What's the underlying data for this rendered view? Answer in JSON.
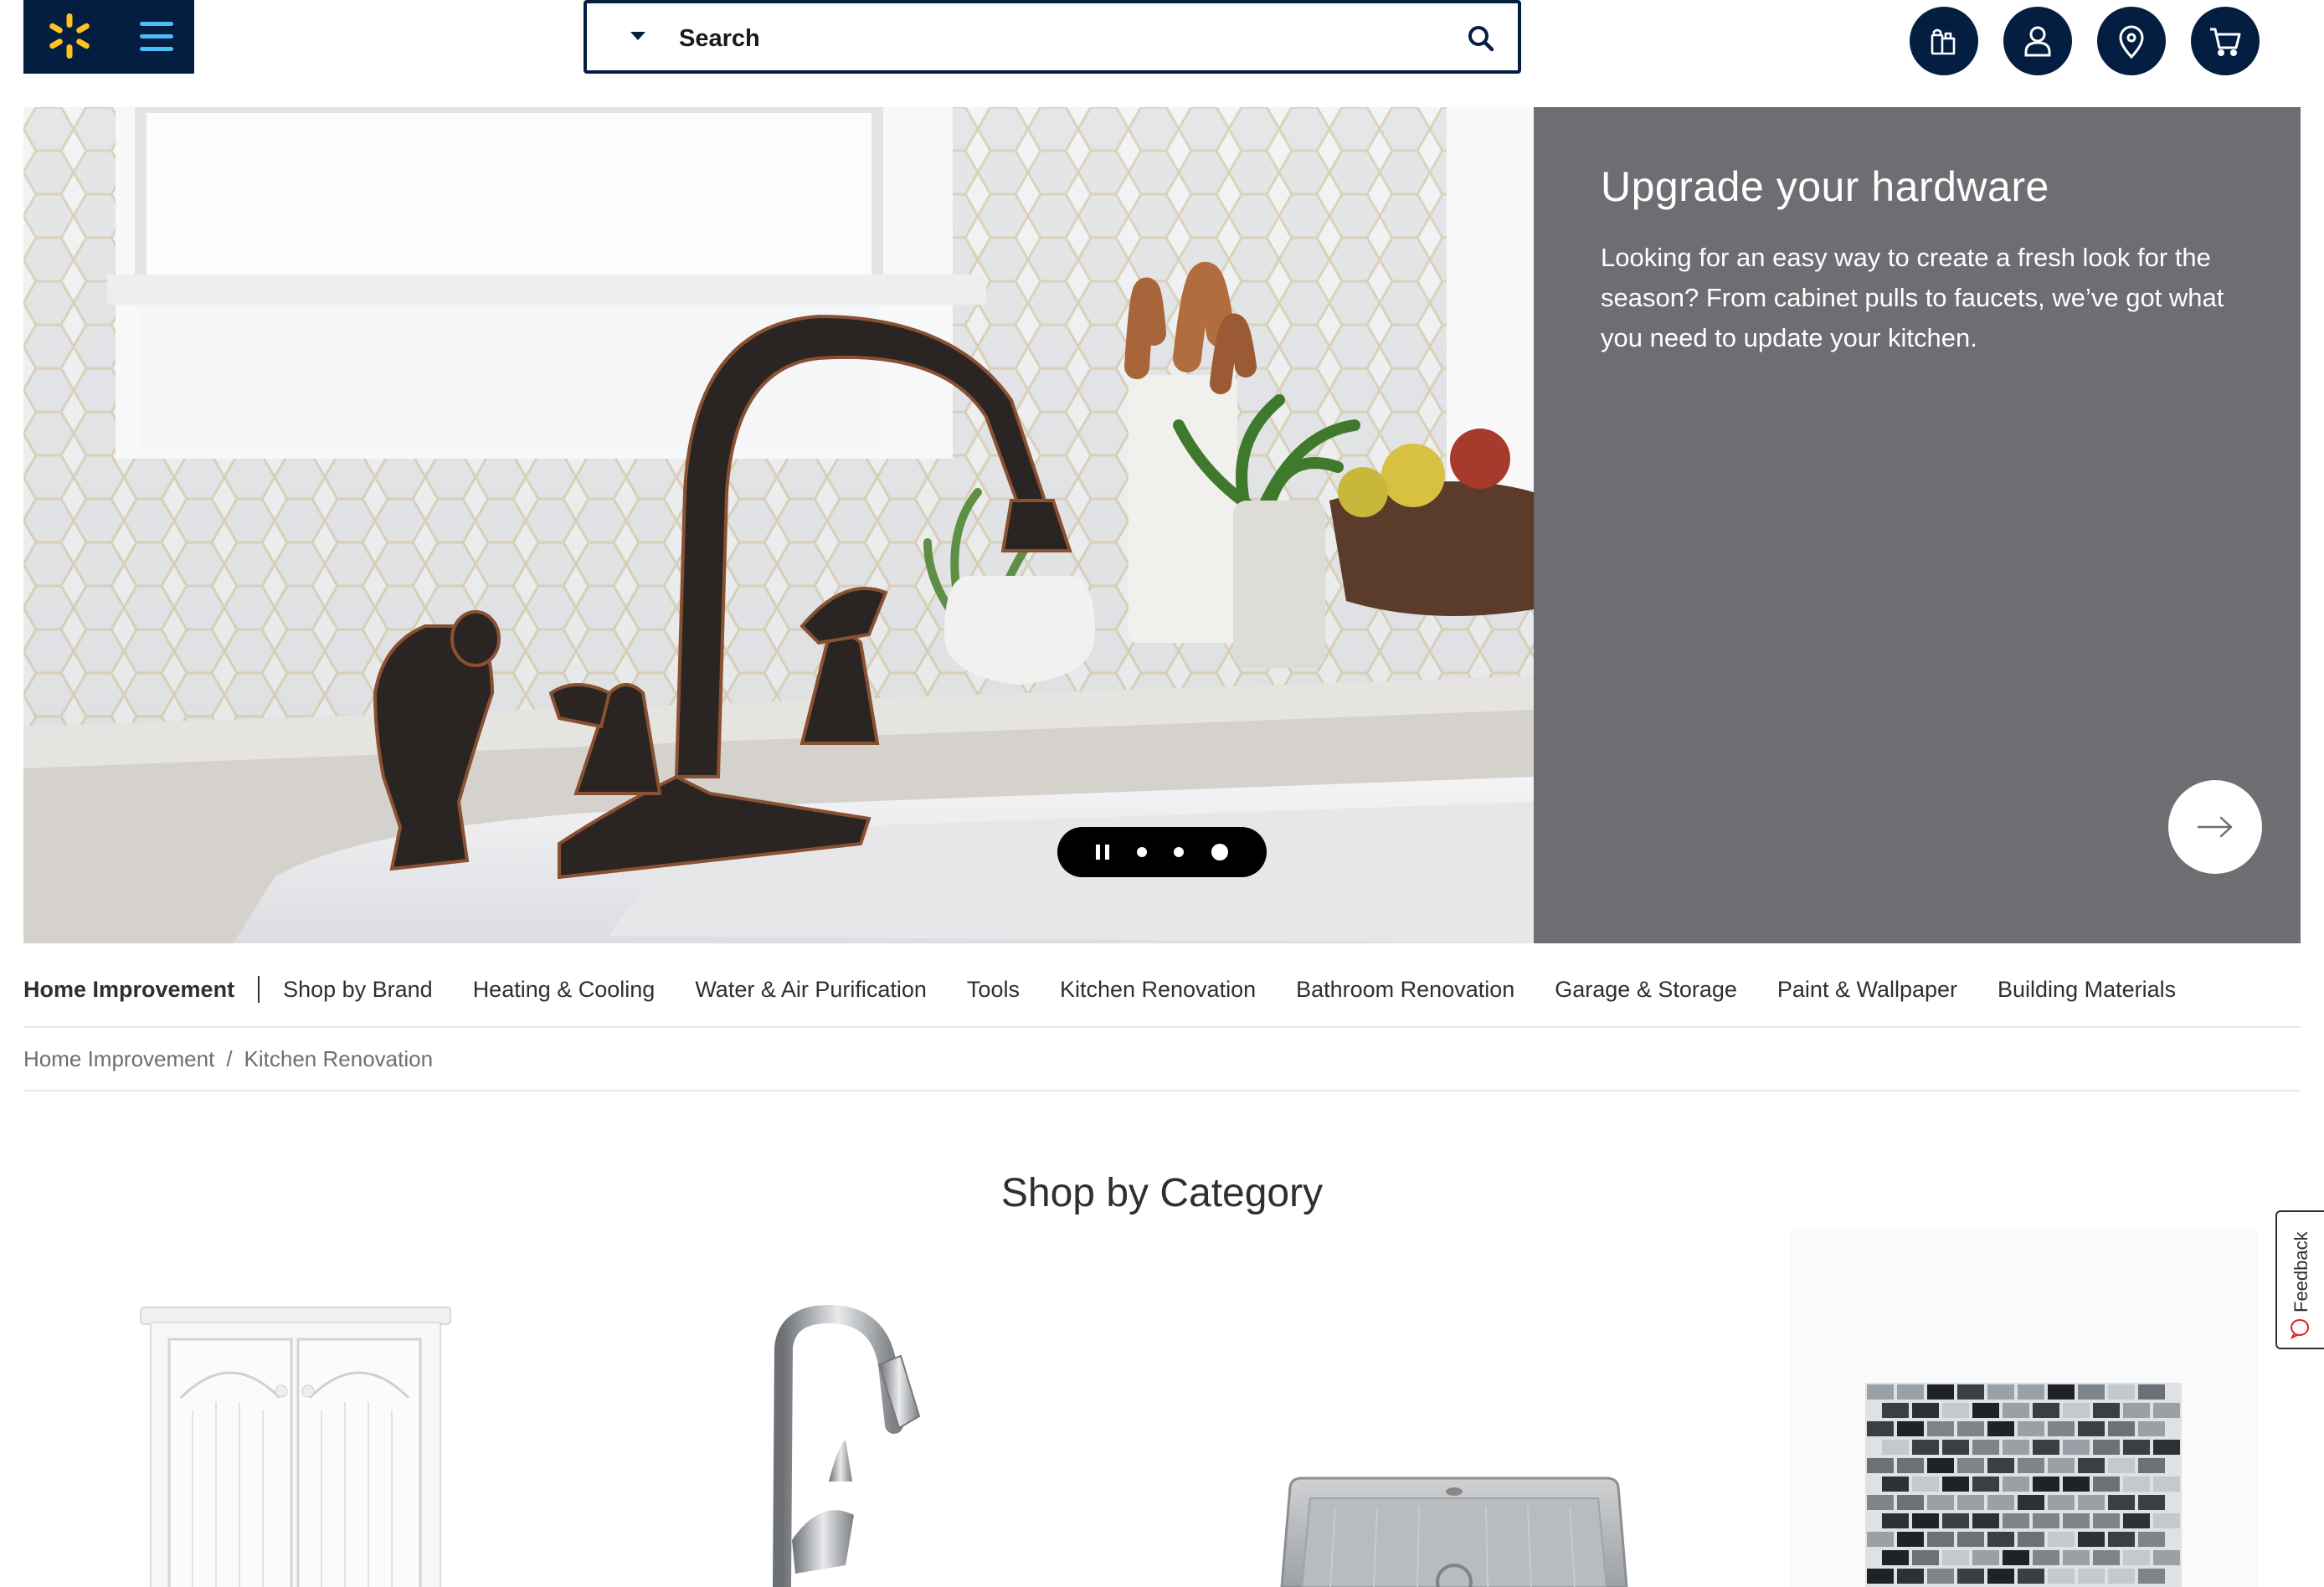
{
  "header": {
    "search_placeholder": "Search",
    "icons": [
      "spark-logo-icon",
      "menu-icon",
      "search-icon",
      "reorder-icon",
      "account-icon",
      "store-location-icon",
      "cart-icon"
    ]
  },
  "hero": {
    "title": "Upgrade your hardware",
    "body": "Looking for an easy way to create a fresh look for the season? From cabinet pulls to faucets, we’ve got what you need to update your kitchen.",
    "panel_color": "#6d6e72",
    "slide_count": 3,
    "active_slide": 3
  },
  "category_nav": {
    "home": "Home Improvement",
    "items": [
      "Shop by Brand",
      "Heating & Cooling",
      "Water & Air Purification",
      "Tools",
      "Kitchen Renovation",
      "Bathroom Renovation",
      "Garage & Storage",
      "Paint & Wallpaper",
      "Building Materials"
    ]
  },
  "breadcrumb": {
    "items": [
      "Home Improvement",
      "Kitchen Renovation"
    ],
    "separator": "/"
  },
  "shop_by_category": {
    "title": "Shop by Category"
  },
  "feedback": {
    "label": "Feedback"
  },
  "colors": {
    "brand_navy": "#041e42",
    "spark_yellow": "#ffc220",
    "menu_blue": "#4dbdf5"
  }
}
